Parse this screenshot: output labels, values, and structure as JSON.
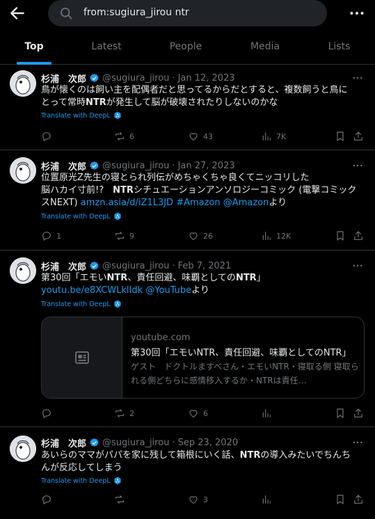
{
  "search": {
    "query": "from:sugiura_jirou ntr"
  },
  "tabs": [
    {
      "label": "Top",
      "active": true
    },
    {
      "label": "Latest",
      "active": false
    },
    {
      "label": "People",
      "active": false
    },
    {
      "label": "Media",
      "active": false
    },
    {
      "label": "Lists",
      "active": false
    }
  ],
  "colors": {
    "accent": "#1d9bf0",
    "background": "#000000",
    "muted": "#71767b",
    "divider": "#2f3336"
  },
  "icons": {
    "back": "arrow-left-icon",
    "search": "search-icon",
    "more": "more-horizontal-icon",
    "verified": "verified-badge-icon",
    "reply": "reply-icon",
    "repost": "repost-icon",
    "like": "like-icon",
    "views": "views-icon",
    "bookmark": "bookmark-icon",
    "share": "share-icon",
    "deepl": "deepl-icon",
    "card_placeholder": "article-placeholder-icon"
  },
  "posts": [
    {
      "author": "杉浦　次郎",
      "handle": "@sugiura_jirou",
      "separator": "·",
      "date": "Jan 12, 2023",
      "text_parts": {
        "p1": "鳥が懐くのは飼い主を配偶者だと思ってるからだとすると、複数飼うと鳥に",
        "p2": "とって常時",
        "p3": "NTR",
        "p4": "が発生して脳が破壊されたりしないのかな"
      },
      "translate": "Translate with DeepL",
      "replies": "",
      "reposts": "6",
      "likes": "43",
      "views": "7K"
    },
    {
      "author": "杉浦　次郎",
      "handle": "@sugiura_jirou",
      "separator": "·",
      "date": "Jan 27, 2023",
      "text_parts": {
        "p1": "位置原光Z先生の寝とられ列伝がめちゃくちゃ良くてニッコリした",
        "p2": "脳ハカイ寸前!?　",
        "p3": "NTR",
        "p4": "シチュエーションアンソロジーコミック (電撃コミック",
        "p5": "スNEXT) ",
        "link1": "amzn.asia/d/iZ1L3JD",
        "p6": " ",
        "link2": "#Amazon",
        "p7": " ",
        "link3": "@Amazon",
        "p8": "より"
      },
      "translate": "Translate with DeepL",
      "replies": "1",
      "reposts": "9",
      "likes": "26",
      "views": "12K"
    },
    {
      "author": "杉浦　次郎",
      "handle": "@sugiura_jirou",
      "separator": "·",
      "date": "Feb 7, 2021",
      "text_parts": {
        "p1": "第30回「エモい",
        "p2": "NTR",
        "p3": "、責任回避、味覇としての",
        "p4": "NTR",
        "p5": "」",
        "link1": "youtu.be/e8XCWLklIdk",
        "p6": " ",
        "link2": "@YouTube",
        "p7": "より"
      },
      "translate": "Translate with DeepL",
      "card": {
        "domain": "youtube.com",
        "title": "第30回「エモいNTR、責任回避、味覇としてのNTR」",
        "description": "ゲスト　ドクトルますべさん・エモいNTR・寝取る側 寝取られる側どちらに感情移入するか・NTRは責任…"
      },
      "replies": "",
      "reposts": "2",
      "likes": "6",
      "views": ""
    },
    {
      "author": "杉浦　次郎",
      "handle": "@sugiura_jirou",
      "separator": "·",
      "date": "Sep 23, 2020",
      "text_parts": {
        "p1": "あいらのママがパパを家に残して箱根にいく話、",
        "p2": "NTR",
        "p3": "の導入みたいでちんち",
        "p4": "んが反応してしまう"
      },
      "translate": "Translate with DeepL",
      "replies": "",
      "reposts": "",
      "likes": "3",
      "views": ""
    }
  ]
}
